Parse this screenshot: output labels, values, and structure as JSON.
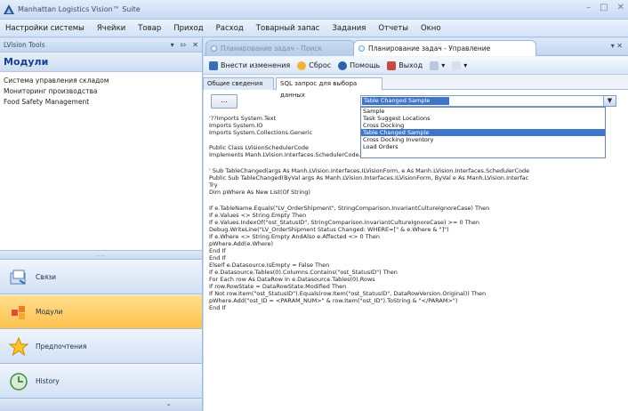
{
  "window": {
    "title": "Manhattan Logistics Vision™ Suite"
  },
  "menu": [
    "Настройки системы",
    "Ячейки",
    "Товар",
    "Приход",
    "Расход",
    "Товарный запас",
    "Задания",
    "Отчеты",
    "Окно"
  ],
  "left_panel": {
    "header": "LVision Tools",
    "title": "Модули",
    "modules": [
      "Система управления складом",
      "Мониторинг производства",
      "Food Safety Management"
    ],
    "nav": [
      "Связи",
      "Модули",
      "Предпочтения",
      "History"
    ]
  },
  "doc_tabs": {
    "inactive": "Планирование задач - Поиск",
    "active": "Планирование задач - Управление"
  },
  "toolbar": {
    "save": "Внести изменения",
    "reset": "Сброс",
    "help": "Помощь",
    "exit": "Выход"
  },
  "sub_tabs": [
    "Общие сведения",
    "SQL запрос для выбора данных"
  ],
  "small_button": "...",
  "combo": {
    "selected": "Table Changed Sample"
  },
  "dropdown_options": [
    "Sample",
    "Task Suggest Locations",
    "Cross Docking",
    "Table Changed Sample",
    "Cross Docking Inventory",
    "Load Orders"
  ],
  "code_lines": [
    "'??Imports System.Text",
    "Imports System.IO",
    "Imports System.Collections.Generic",
    "Public Class LVisionSchedulerCode",
    "    Implements Manh.LVision.Interfaces.SchedulerCode.ISchedulerCustom_2",
    "'   Sub TableChanged(args As Manh.LVision.Interfaces.ILVisionForm, e As Manh.LVision.Interfaces.SchedulerCode",
    "    Public Sub TableChanged(ByVal args As Manh.LVision.Interfaces.ILVisionForm, ByVal e As Manh.LVision.Interfac",
    "      Try",
    "        Dim pWhere As New List(Of String)",
    "        If e.TableName.Equals(\"LV_OrderShipment\", StringComparison.InvariantCultureIgnoreCase) Then",
    "          If e.Values <> String.Empty Then",
    "            If e.Values.IndexOf(\"ost_StatusID\", StringComparison.InvariantCultureIgnoreCase) >= 0 Then",
    "              Debug.WriteLine(\"LV_OrderShipment Status Changed: WHERE=[\" & e.Where & \"]\")",
    "              If e.Where <> String.Empty AndAlso e.Affected <> 0 Then",
    "                pWhere.Add(e.Where)",
    "              End If",
    "            End If",
    "          ElseIf e.Datasource.IsEmpty = False Then",
    "            If e.Datasource.Tables(0).Columns.Contains(\"ost_StatusID\") Then",
    "              For Each row As DataRow In e.Datasource.Tables(0).Rows",
    "                If row.RowState = DataRowState.Modified Then",
    "                  If Not row.Item(\"ost_StatusID\").Equals(row.Item(\"ost_StatusID\", DataRowVersion.Original)) Then",
    "                    pWhere.Add(\"ost_ID = <PARAM_NUM>\" & row.Item(\"ost_ID\").ToString & \"</PARAM>\")",
    "                  End If"
  ]
}
